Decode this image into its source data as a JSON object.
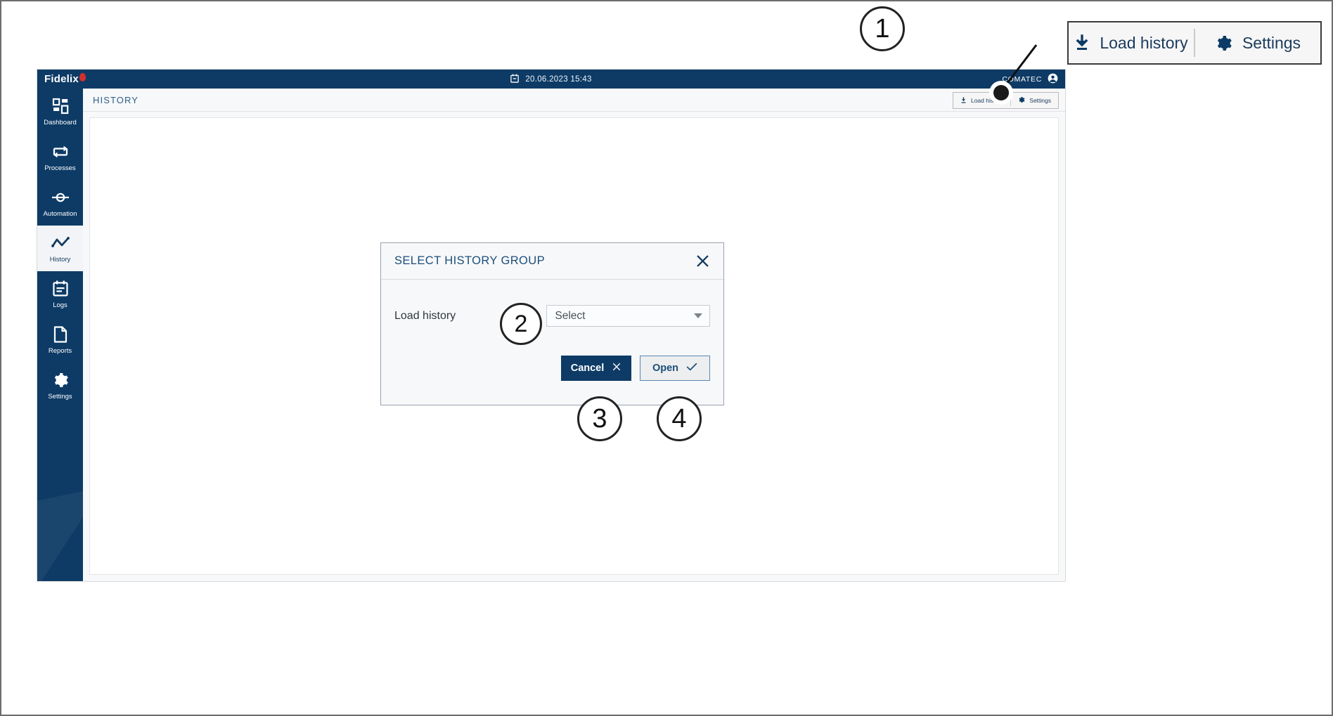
{
  "callouts": [
    {
      "id": "1",
      "label": "1"
    },
    {
      "id": "2",
      "label": "2"
    },
    {
      "id": "3",
      "label": "3"
    },
    {
      "id": "4",
      "label": "4"
    }
  ],
  "zoom_toolbar": {
    "load_history_label": "Load history",
    "load_history_icon": "download-icon",
    "settings_label": "Settings",
    "settings_icon": "gear-icon"
  },
  "app": {
    "topbar": {
      "brand": "Fidelix",
      "brand_badge_icon": "notification-dot-icon",
      "clock_icon": "calendar-icon",
      "datetime": "20.06.2023  15:43",
      "user": "COMATEC",
      "user_icon": "user-avatar-icon"
    },
    "sidebar": {
      "items": [
        {
          "label": "Dashboard",
          "icon": "grid-icon",
          "active": false
        },
        {
          "label": "Processes",
          "icon": "swap-arrows-icon",
          "active": false
        },
        {
          "label": "Automation",
          "icon": "valve-icon",
          "active": false
        },
        {
          "label": "History",
          "icon": "trend-line-icon",
          "active": true
        },
        {
          "label": "Logs",
          "icon": "calendar-list-icon",
          "active": false
        },
        {
          "label": "Reports",
          "icon": "document-icon",
          "active": false
        },
        {
          "label": "Settings",
          "icon": "gear-icon",
          "active": false
        }
      ]
    },
    "page": {
      "title": "HISTORY",
      "toolbar": {
        "load_history_label": "Load history",
        "load_history_icon": "download-icon",
        "settings_label": "Settings",
        "settings_icon": "gear-icon"
      }
    },
    "modal": {
      "title": "SELECT HISTORY GROUP",
      "close_icon": "close-icon",
      "field_label": "Load history",
      "select_value": "Select",
      "select_caret_icon": "chevron-down-icon",
      "cancel_label": "Cancel",
      "cancel_icon": "close-icon",
      "open_label": "Open",
      "open_icon": "check-icon"
    }
  },
  "colors": {
    "brand_navy": "#0d3b66",
    "accent_blue": "#1b4e79",
    "badge_red": "#d32f2f",
    "panel_bg": "#f7f8fa"
  }
}
